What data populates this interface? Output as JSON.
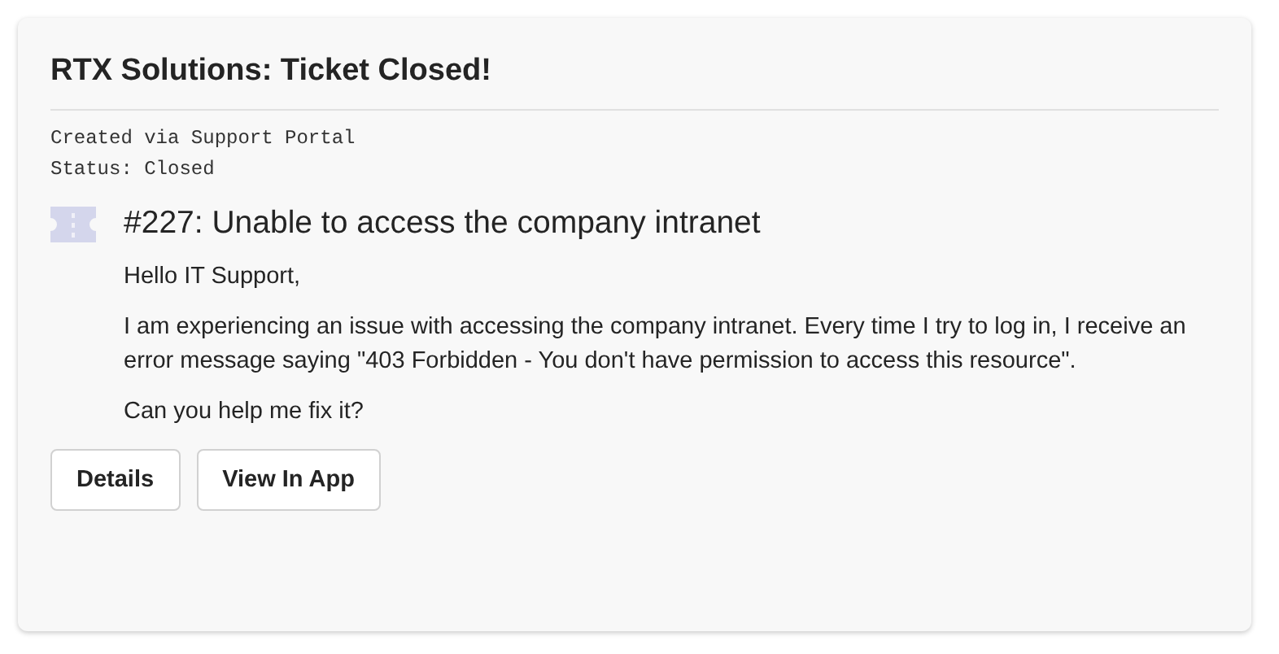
{
  "card": {
    "title": "RTX Solutions: Ticket Closed!",
    "meta": [
      "Created via Support Portal",
      "Status: Closed"
    ],
    "ticket": {
      "heading": "#227: Unable to access the company intranet",
      "paragraphs": [
        "Hello IT Support,",
        "I am experiencing an issue with accessing the company intranet. Every time I try to log in, I receive an error message saying \"403 Forbidden - You don't have permission to access this resource\".",
        "Can you help me fix it?"
      ]
    },
    "buttons": [
      "Details",
      "View In App"
    ]
  }
}
